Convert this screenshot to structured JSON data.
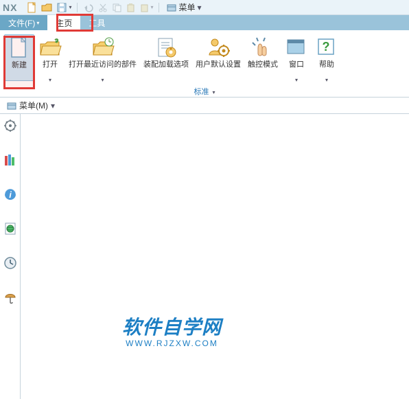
{
  "app": {
    "logo": "NX"
  },
  "qat": {
    "menu_label": "菜单"
  },
  "tabs": {
    "file": "文件(F)",
    "home": "主页",
    "tools": "工具"
  },
  "ribbon": {
    "new": "新建",
    "open": "打开",
    "recent": "打开最近访问的部件",
    "assembly": "装配加载选项",
    "userdef": "用户默认设置",
    "touch": "触控模式",
    "window": "窗口",
    "help": "帮助",
    "group": "标准"
  },
  "menubar": {
    "menu": "菜单(M)"
  },
  "watermark": {
    "line1": "软件自学网",
    "line2": "WWW.RJZXW.COM"
  }
}
